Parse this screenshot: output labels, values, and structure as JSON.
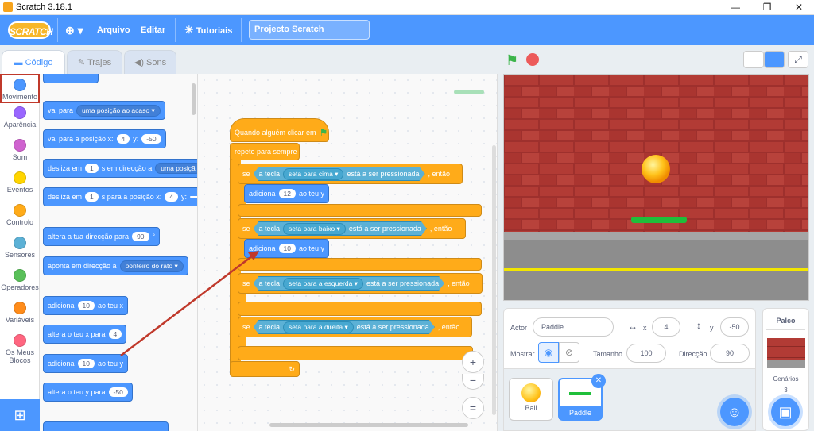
{
  "window": {
    "title": "Scratch 3.18.1",
    "minimize": "—",
    "restore": "❐",
    "close": "✕"
  },
  "menu": {
    "logo": "SCRATCH",
    "globe": "⊕ ▾",
    "file": "Arquivo",
    "edit": "Editar",
    "tutorials": "Tutoriais",
    "project_name": "Projecto Scratch"
  },
  "tabs": {
    "code": "Código",
    "costumes": "Trajes",
    "sounds": "Sons"
  },
  "categories": [
    {
      "label": "Movimento",
      "color": "#4c97ff"
    },
    {
      "label": "Aparência",
      "color": "#9966ff"
    },
    {
      "label": "Som",
      "color": "#cf63cf"
    },
    {
      "label": "Eventos",
      "color": "#ffd500"
    },
    {
      "label": "Controlo",
      "color": "#ffab19"
    },
    {
      "label": "Sensores",
      "color": "#5cb1d6"
    },
    {
      "label": "Operadores",
      "color": "#59c059"
    },
    {
      "label": "Variáveis",
      "color": "#ff8c1a"
    },
    {
      "label": "Os Meus Blocos",
      "color": "#ff6680"
    }
  ],
  "palette": {
    "goto_label": "vai para",
    "goto_target": "uma posição ao acaso",
    "gotoxy_label": "vai para a posição x:",
    "gotoxy_x": "4",
    "gotoxy_y_label": "y:",
    "gotoxy_y": "-50",
    "glide1_label": "desliza em",
    "glide1_secs": "1",
    "glide1_mid": "s em direcção a",
    "glide1_target": "uma posiçã",
    "glide2_label": "desliza em",
    "glide2_secs": "1",
    "glide2_mid": "s para a posição x:",
    "glide2_x": "4",
    "glide2_y_label": "y:",
    "setdir_label": "altera a tua direcção para",
    "setdir_value": "90",
    "setdir_unit": "°",
    "point_label": "aponta em direcção a",
    "point_target": "ponteiro do rato",
    "changex_label": "adiciona",
    "changex_value": "10",
    "changex_suffix": "ao teu x",
    "setx_label": "altera o teu x para",
    "setx_value": "4",
    "changey_label": "adiciona",
    "changey_value": "10",
    "changey_suffix": "ao teu y",
    "sety_label": "altera o teu y para",
    "sety_value": "-50"
  },
  "script": {
    "hat": "Quando alguém clicar em",
    "forever": "repete para sempre",
    "if_label": "se",
    "key_prefix": "a tecla",
    "pressed": "está a ser pressionada",
    "then": ", então",
    "keys": [
      "seta para cima",
      "seta para baixo",
      "seta para a esquerda",
      "seta para a direita"
    ],
    "change_label": "adiciona",
    "change_up_value": "12",
    "change_down_value": "10",
    "change_suffix": "ao teu y",
    "loop_arrow": "↻"
  },
  "zoom": {
    "in": "+",
    "out": "−",
    "reset": "="
  },
  "sprite_info": {
    "actor_label": "Actor",
    "actor_name": "Paddle",
    "x_label": "x",
    "x_value": "4",
    "y_label": "y",
    "y_value": "-50",
    "show_label": "Mostrar",
    "size_label": "Tamanho",
    "size_value": "100",
    "dir_label": "Direcção",
    "dir_value": "90"
  },
  "sprites": [
    {
      "name": "Ball"
    },
    {
      "name": "Paddle"
    }
  ],
  "stage_pane": {
    "title": "Palco",
    "backdrops_label": "Cenários",
    "backdrops_count": "3"
  },
  "colors": {
    "motion": "#4c97ff",
    "control": "#ffab19",
    "sensing": "#5cb1d6",
    "events": "#ffbf00",
    "brick": "#b23b35",
    "highlight": "#c0392b"
  }
}
